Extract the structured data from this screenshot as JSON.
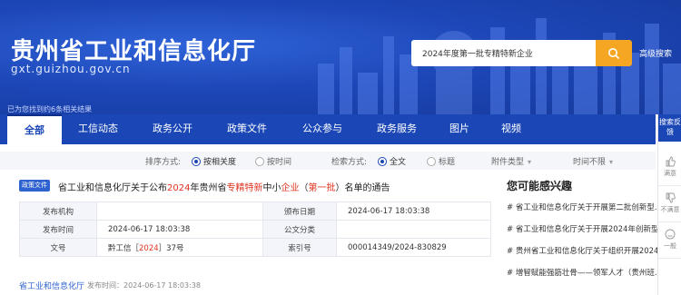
{
  "header": {
    "site_title": "贵州省工业和信息化厅",
    "site_domain": "gxt.guizhou.gov.cn",
    "search_value": "2024年度第一批专精特新企业",
    "advanced_search": "高级搜索",
    "result_count_note": "已为您找到约6条相关结果"
  },
  "nav": {
    "items": [
      "全部",
      "工信动态",
      "政务公开",
      "政策文件",
      "公众参与",
      "政务服务",
      "图片",
      "视频"
    ]
  },
  "filters": {
    "sort_label": "排序方式:",
    "sort_options": [
      "按相关度",
      "按时间"
    ],
    "search_mode_label": "检索方式:",
    "search_mode_options": [
      "全文",
      "标题"
    ],
    "file_type": "附件类型",
    "time_limit": "时间不限"
  },
  "result": {
    "tag": "政策文件",
    "title_parts": [
      "省工业和信息化厅关于公布",
      "2024",
      "年贵州省",
      "专精特新",
      "中小",
      "企业",
      "（",
      "第一批",
      "）名单的通告"
    ],
    "meta": {
      "publisher_label": "发布机构",
      "publisher_value": "",
      "issue_date_label": "颁布日期",
      "issue_date_value": "2024-06-17 18:03:38",
      "publish_time_label": "发布时间",
      "publish_time_value": "2024-06-17 18:03:38",
      "category_label": "公文分类",
      "category_value": "",
      "doc_no_label": "文号",
      "doc_no_prefix": "黔工信［",
      "doc_no_year": "2024",
      "doc_no_suffix": "］37号",
      "index_label": "索引号",
      "index_value": "000014349/2024-830829"
    },
    "source": "省工业和信息化厅",
    "source_date": "发布时间：2024-06-17 18:03:38"
  },
  "recommend": {
    "title": "您可能感兴趣",
    "items": [
      "# 省工业和信息化厅关于开展第二批创新型...",
      "# 省工业和信息化厅关于开展2024年创新型...",
      "# 贵州省工业和信息化厅关于组织开展2024...",
      "# 增智赋能强筋壮骨——领军人才（贵州班..."
    ]
  },
  "side_float": {
    "top_label": "搜索反馈",
    "cells": [
      "满意",
      "不满意",
      "一般"
    ]
  },
  "colors": {
    "brand_blue": "#1a46b6",
    "search_orange": "#f5a623",
    "highlight_red": "#e0331f"
  }
}
